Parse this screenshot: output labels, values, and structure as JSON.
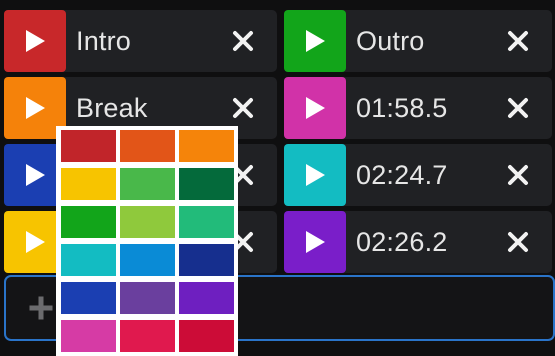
{
  "cues": [
    {
      "label": "Intro",
      "color": "#c8282a"
    },
    {
      "label": "Outro",
      "color": "#12a51a"
    },
    {
      "label": "Break",
      "color": "#f5820a"
    },
    {
      "label": "01:58.5",
      "color": "#d132a8"
    },
    {
      "label": "",
      "color": "#1b3fb2"
    },
    {
      "label": "02:24.7",
      "color": "#13bcc2"
    },
    {
      "label": "",
      "color": "#f7c400"
    },
    {
      "label": "02:26.2",
      "color": "#7a1ec9"
    }
  ],
  "icons": {
    "play": "play-icon",
    "delete": "close-icon",
    "add": "plus-icon"
  },
  "colors": {
    "add_row_border": "#2a74c9",
    "cue_bg": "#202124",
    "page_bg": "#0f0f10"
  },
  "palette": [
    "#c1252a",
    "#e25518",
    "#f5840a",
    "#f7c400",
    "#49b84a",
    "#046a3b",
    "#12a51a",
    "#8fc93c",
    "#22bb7a",
    "#13bcc2",
    "#0a8bd6",
    "#162f8e",
    "#1b3fb2",
    "#6a3f9e",
    "#6e1fc0",
    "#d63ba5",
    "#e0194e",
    "#cc0c37"
  ]
}
